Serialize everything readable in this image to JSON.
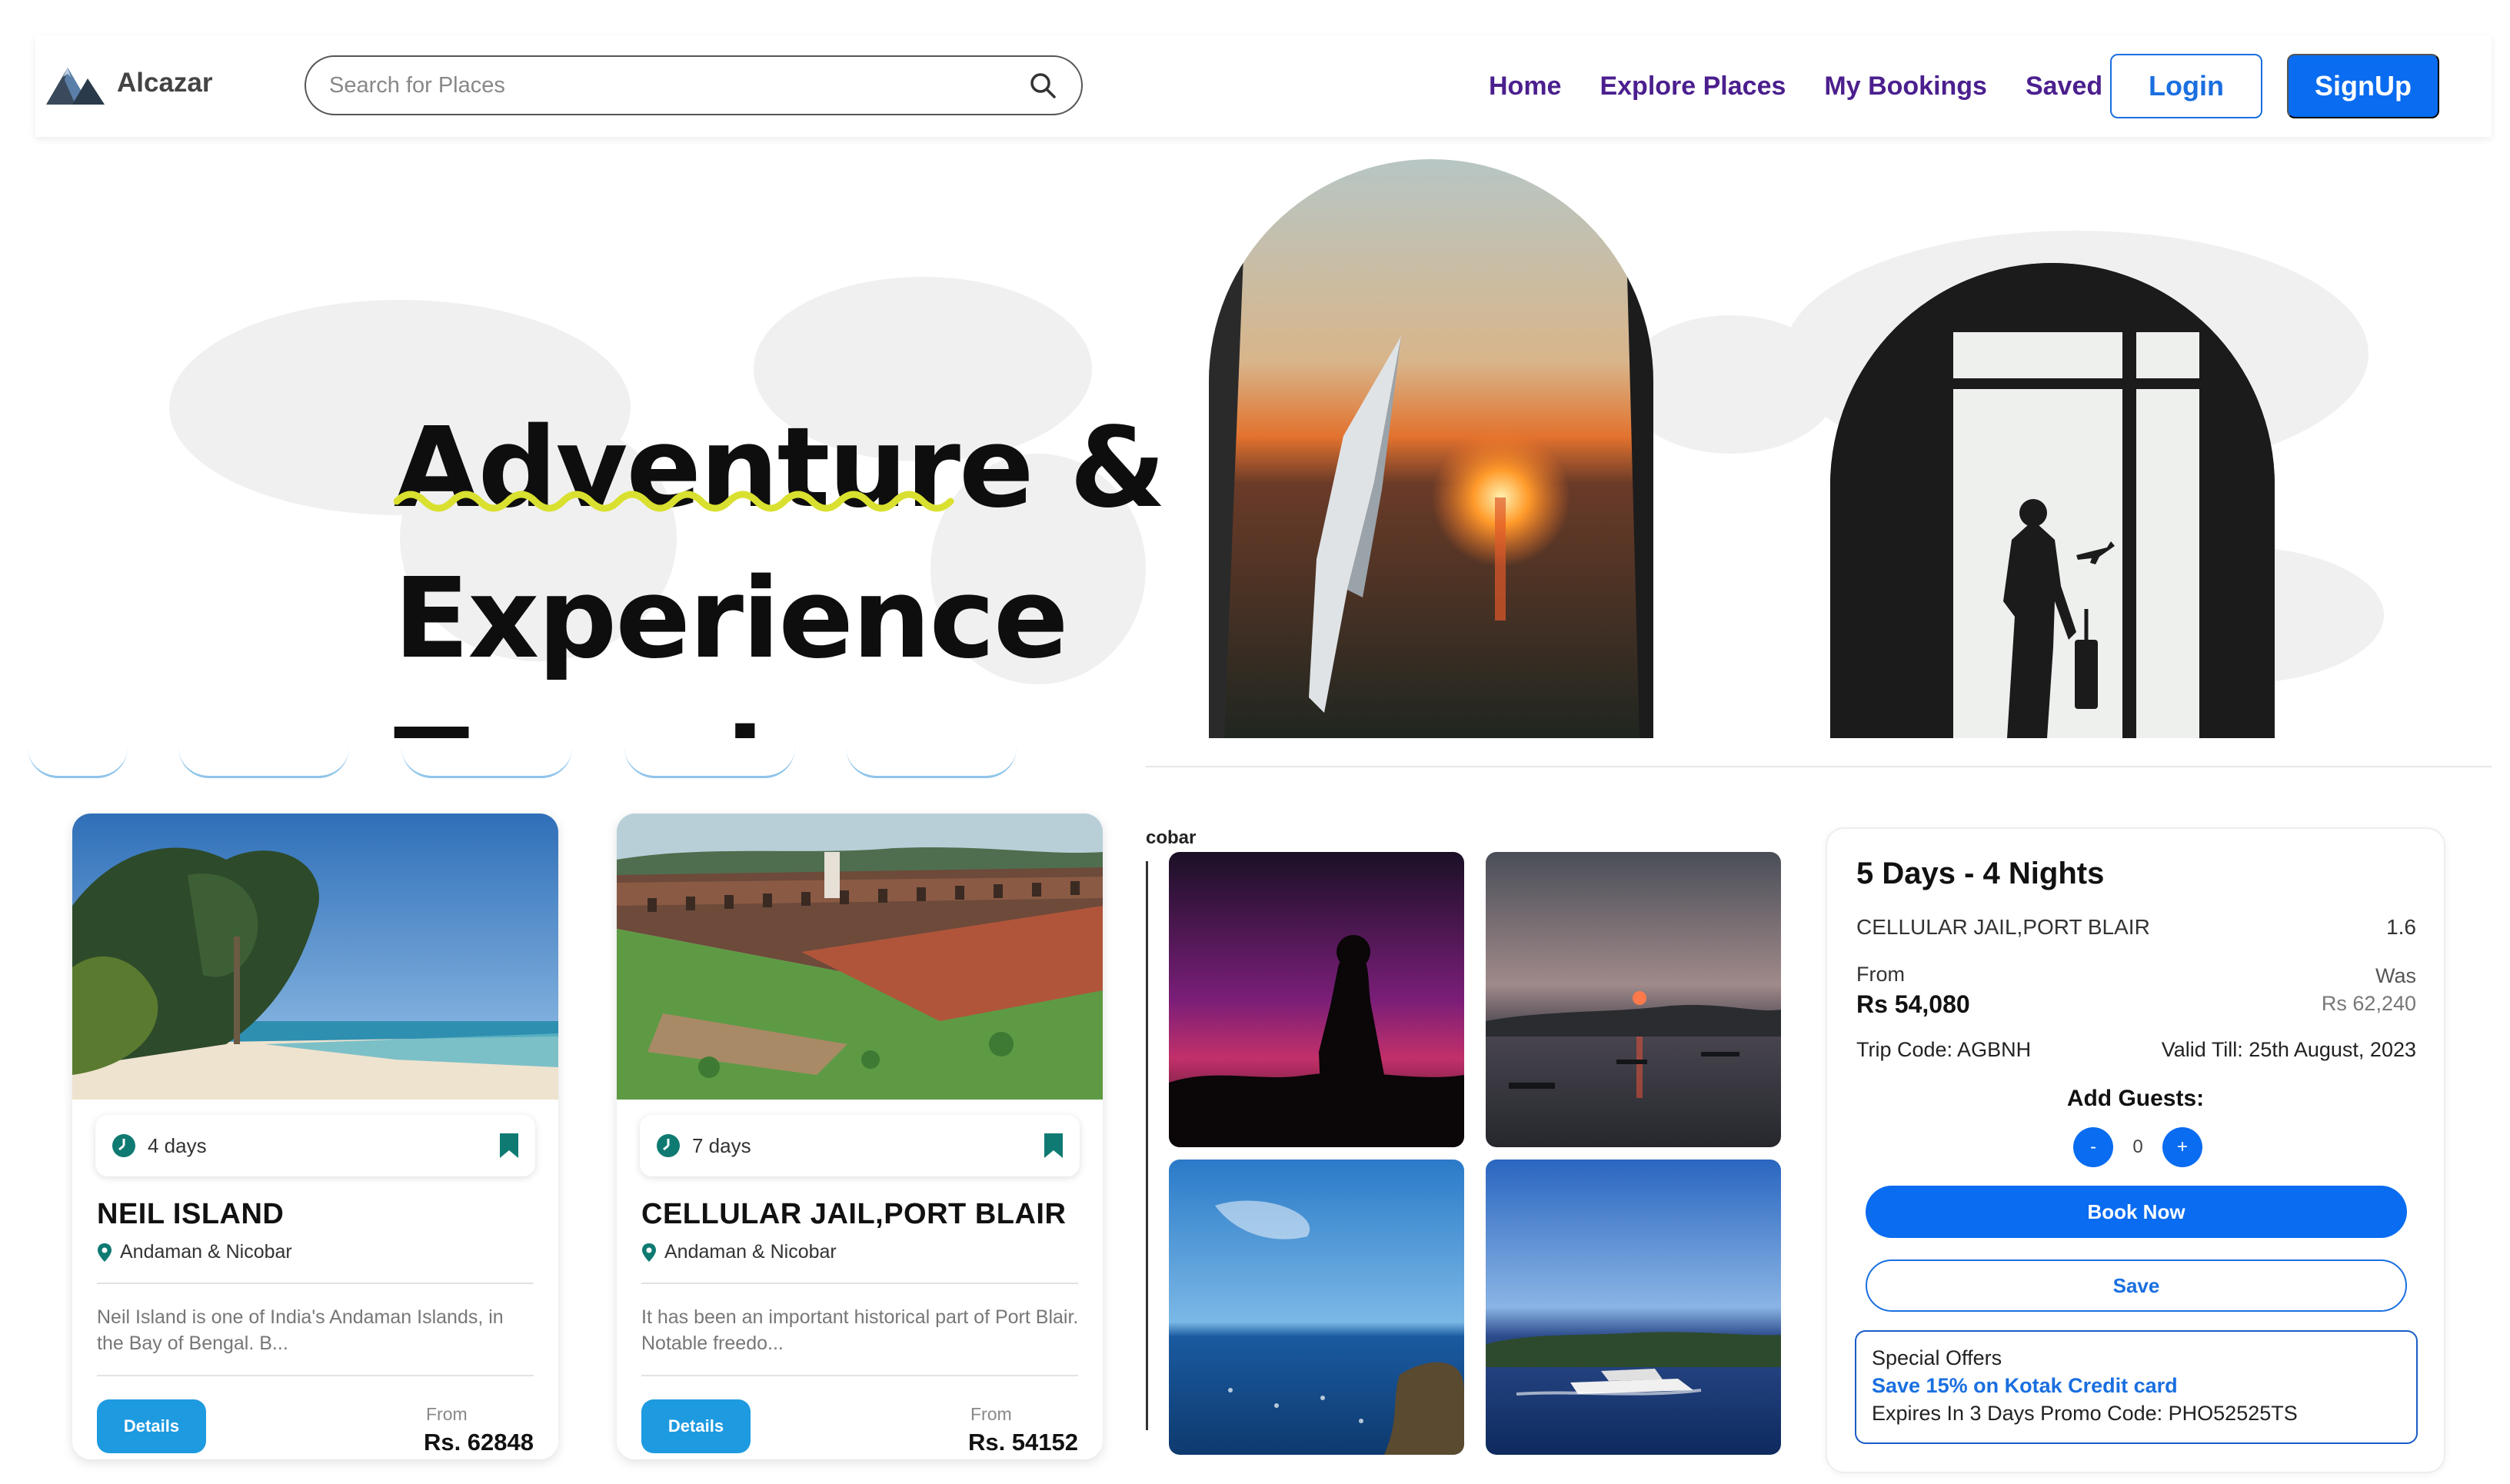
{
  "app": {
    "name": "Alcazar"
  },
  "search": {
    "placeholder": "Search for Places"
  },
  "nav": {
    "links": [
      "Home",
      "Explore Places",
      "My Bookings",
      "Saved"
    ],
    "login": "Login",
    "signup": "SignUp"
  },
  "hero": {
    "line1": "Adventure &",
    "line2": "Experience",
    "line3": "Travel"
  },
  "cards": [
    {
      "duration": "4 days",
      "title": "NEIL ISLAND",
      "location": "Andaman & Nicobar",
      "description": "Neil Island is one of India's Andaman Islands, in the Bay of Bengal. B...",
      "details_label": "Details",
      "from_label": "From",
      "price": "Rs. 62848"
    },
    {
      "duration": "7 days",
      "title": "CELLULAR JAIL,PORT BLAIR",
      "location": "Andaman & Nicobar",
      "description": "It has been an important historical part of Port Blair. Notable freedo...",
      "details_label": "Details",
      "from_label": "From",
      "price": "Rs. 54152"
    }
  ],
  "gallery": {
    "label": "cobar"
  },
  "booking": {
    "title": "5 Days - 4 Nights",
    "place": "CELLULAR JAIL,PORT BLAIR",
    "rating": "1.6",
    "from_label": "From",
    "from_price": "Rs 54,080",
    "was_label": "Was",
    "was_price": "Rs 62,240",
    "trip_code": "Trip Code: AGBNH",
    "valid_till": "Valid Till: 25th August, 2023",
    "guests_label": "Add Guests:",
    "guests_minus": "-",
    "guests_value": "0",
    "guests_plus": "+",
    "book_now": "Book Now",
    "save": "Save",
    "offers": {
      "title": "Special Offers",
      "link": "Save 15% on Kotak Credit card",
      "promo": "Expires In 3 Days Promo Code: PHO52525TS"
    }
  },
  "colors": {
    "nav_link": "#4b1f8e",
    "primary": "#0a6cf0",
    "details_btn": "#1e9ae0",
    "squiggle": "#d9e02f",
    "teal_icon": "#0e7a72"
  },
  "icons": [
    "mountain-logo-icon",
    "search-icon",
    "clock-icon",
    "bookmark-icon",
    "location-pin-icon"
  ]
}
